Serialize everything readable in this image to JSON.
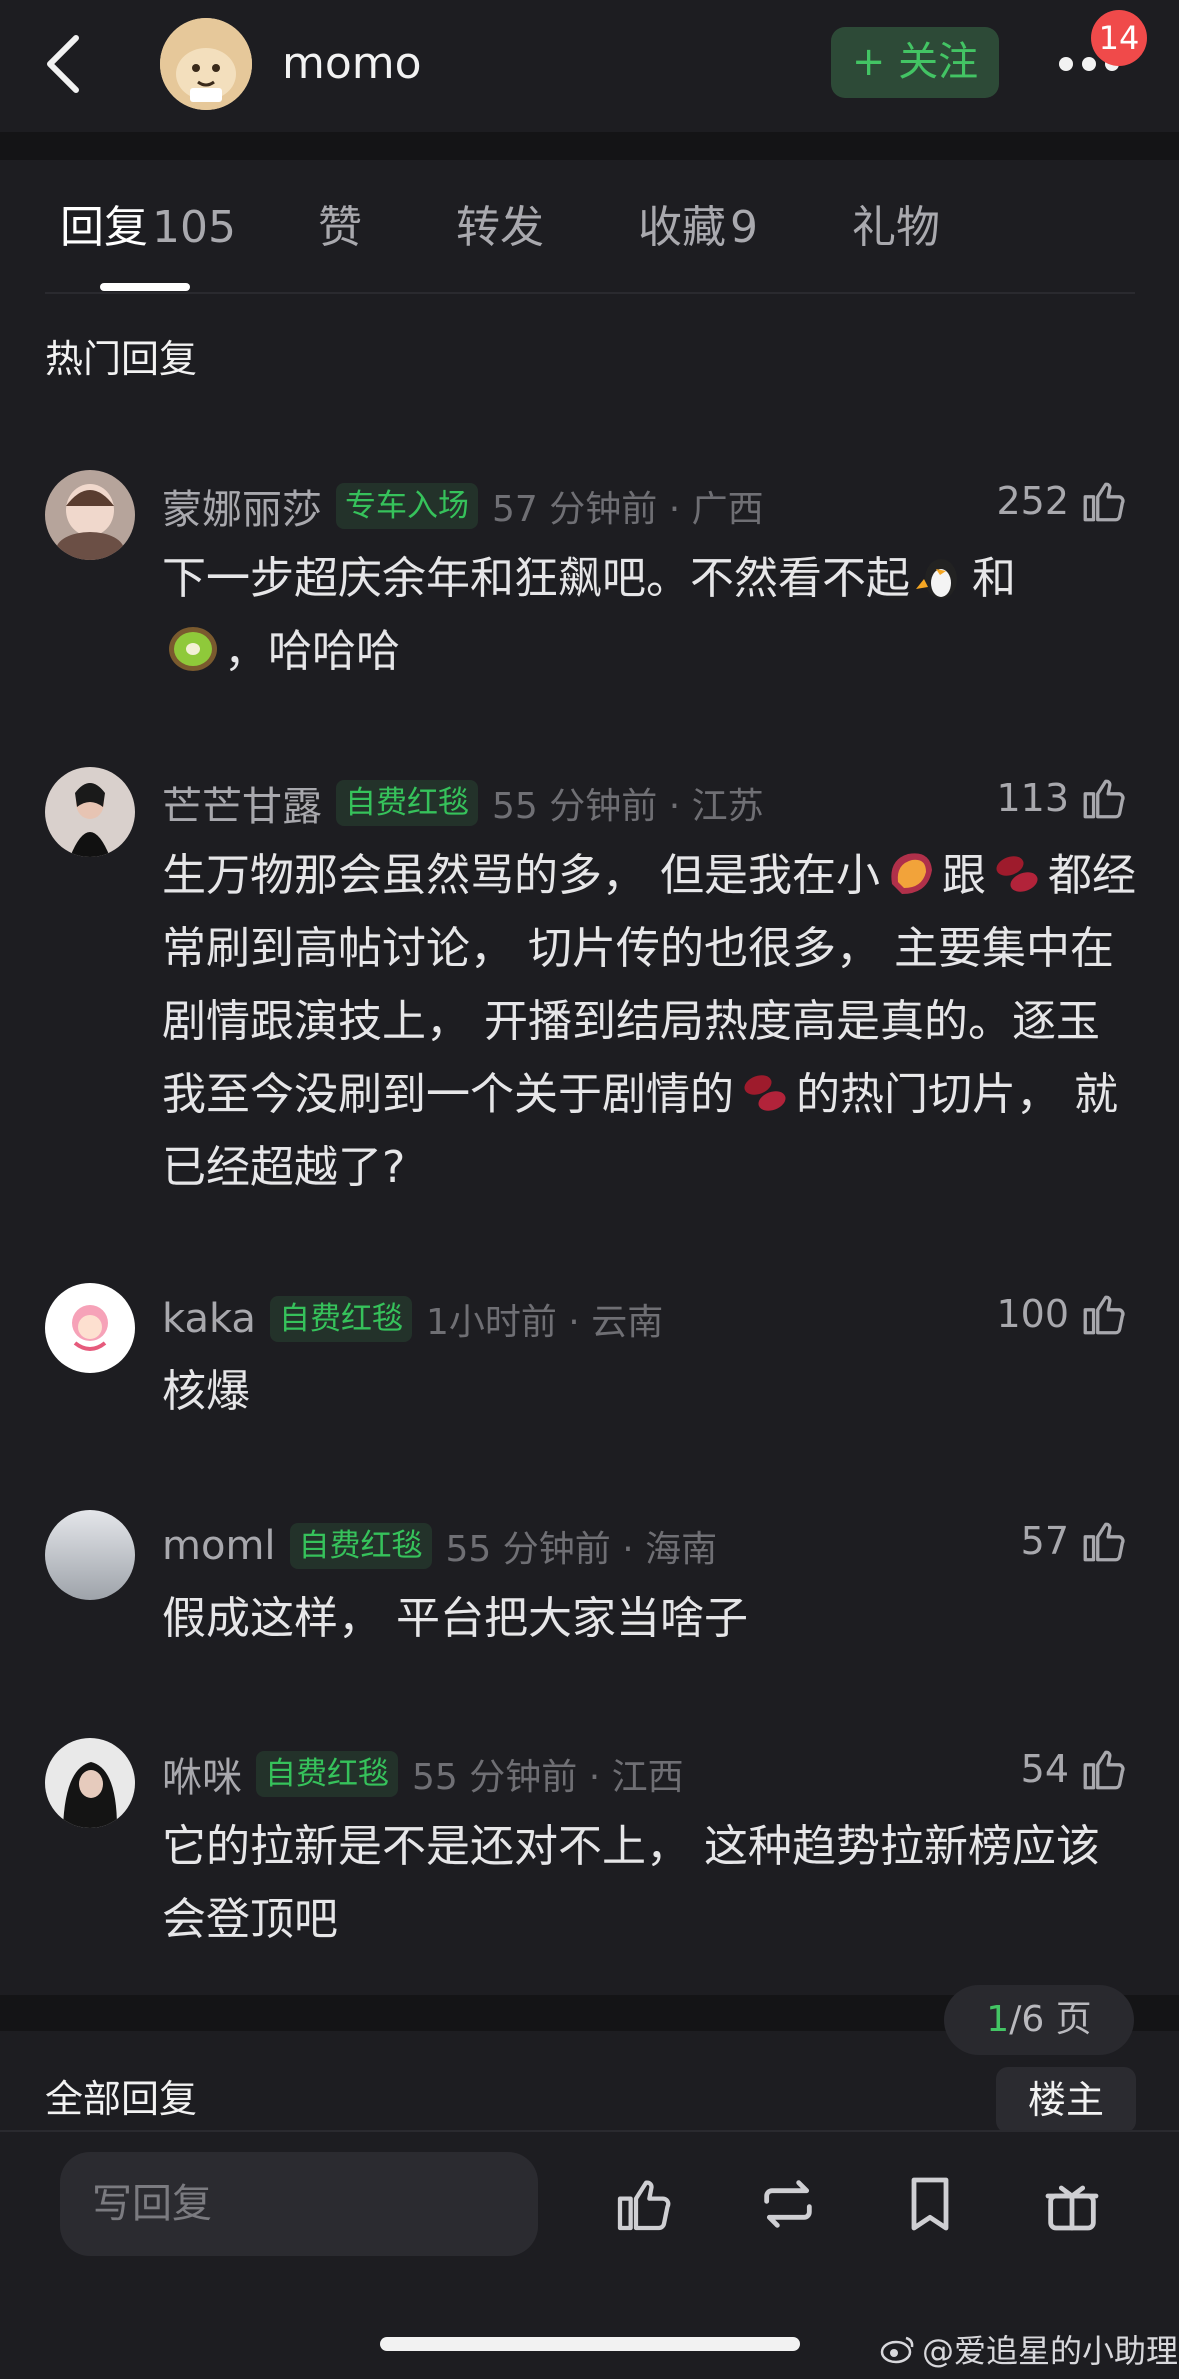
{
  "header": {
    "username": "momo",
    "follow_label": "+ 关注",
    "notification_count": "14",
    "back_icon": "chevron-left-icon",
    "more_icon": "more-dots-icon"
  },
  "tabs": [
    {
      "label": "回复",
      "count": "105",
      "active": true
    },
    {
      "label": "赞",
      "count": ""
    },
    {
      "label": "转发",
      "count": ""
    },
    {
      "label": "收藏",
      "count": "9"
    },
    {
      "label": "礼物",
      "count": ""
    }
  ],
  "hot_section_title": "热门回复",
  "comments": [
    {
      "name": "蒙娜丽莎",
      "tag": "专车入场",
      "meta": "57 分钟前 · 广西",
      "likes": "252",
      "text_parts": [
        "下一步超庆余年和狂飙吧。不然看不起",
        "和",
        "，哈哈哈"
      ]
    },
    {
      "name": "芒芒甘露",
      "tag": "自费红毯",
      "meta": "55 分钟前 · 江苏",
      "likes": "113",
      "text_parts": [
        "生万物那会虽然骂的多， 但是我在小",
        "跟",
        "都经常刷到高帖讨论， 切片传的也很多， 主要集中在剧情跟演技上， 开播到结局热度高是真的。逐玉我至今没刷到一个关于剧情的",
        "的热门切片， 就已经超越了?"
      ]
    },
    {
      "name": "kaka",
      "tag": "自费红毯",
      "meta": "1小时前 · 云南",
      "likes": "100",
      "text_parts": [
        "核爆"
      ]
    },
    {
      "name": "moml",
      "tag": "自费红毯",
      "meta": "55 分钟前 · 海南",
      "likes": "57",
      "text_parts": [
        "假成这样， 平台把大家当啥子"
      ]
    },
    {
      "name": "咻咪",
      "tag": "自费红毯",
      "meta": "55 分钟前 · 江西",
      "likes": "54",
      "text_parts": [
        "它的拉新是不是还对不上， 这种趋势拉新榜应该会登顶吧"
      ]
    }
  ],
  "pager": {
    "current": "1",
    "total_label": "/6 页"
  },
  "all_section_title": "全部回复",
  "owner_button": "楼主",
  "bottom": {
    "reply_placeholder": "写回复",
    "icons": [
      "like-icon",
      "repost-icon",
      "bookmark-icon",
      "gift-icon"
    ]
  },
  "watermark": "@爱追星的小助理",
  "colors": {
    "accent": "#43c464",
    "badge": "#f04a4a",
    "background": "#1d1d21"
  }
}
